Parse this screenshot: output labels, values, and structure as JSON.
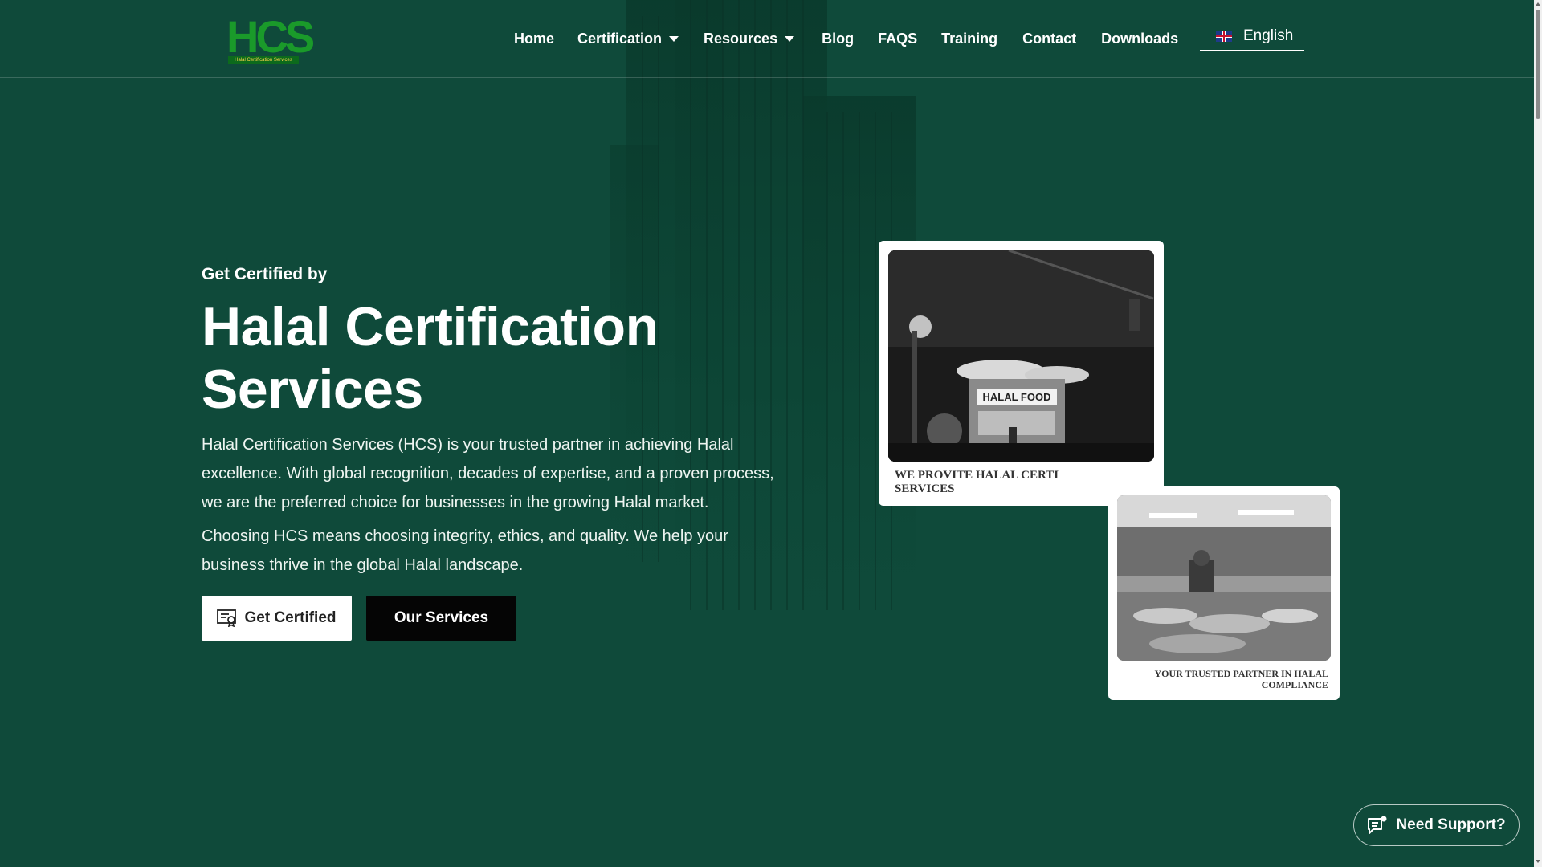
{
  "brand": {
    "logo_mark": "HCS",
    "logo_tagline": "Halal Certification Services"
  },
  "nav": {
    "items": [
      {
        "label": "Home",
        "has_dropdown": false
      },
      {
        "label": "Certification",
        "has_dropdown": true
      },
      {
        "label": "Resources",
        "has_dropdown": true
      },
      {
        "label": "Blog",
        "has_dropdown": false
      },
      {
        "label": "FAQS",
        "has_dropdown": false
      },
      {
        "label": "Training",
        "has_dropdown": false
      },
      {
        "label": "Contact",
        "has_dropdown": false
      },
      {
        "label": "Downloads",
        "has_dropdown": false
      }
    ],
    "language": {
      "label": "English",
      "flag_icon": "uk-flag-icon"
    }
  },
  "hero": {
    "eyebrow": "Get Certified by",
    "title_line1": "Halal Certification",
    "title_line2": "Services",
    "paragraph1": "Halal Certification Services (HCS) is your trusted partner in achieving Halal excellence. With global recognition, decades of expertise, and a proven process, we are the preferred choice for businesses in the growing Halal market.",
    "paragraph2": "Choosing HCS means choosing integrity, ethics, and quality. We help your business thrive in the global Halal landscape.",
    "primary_button": "Get Certified",
    "secondary_button": "Our Services"
  },
  "cards": [
    {
      "caption": "WE PROVITE HALAL CERTI SERVICES",
      "photo_sign": "HALAL FOOD"
    },
    {
      "caption": "YOUR TRUSTED PARTNER IN HALAL COMPLIANCE"
    }
  ],
  "support": {
    "label": "Need Support?"
  },
  "colors": {
    "background": "#0f4a3a",
    "logo_green": "#1a9a2a",
    "button_white": "#ffffff",
    "button_black": "#050505"
  }
}
